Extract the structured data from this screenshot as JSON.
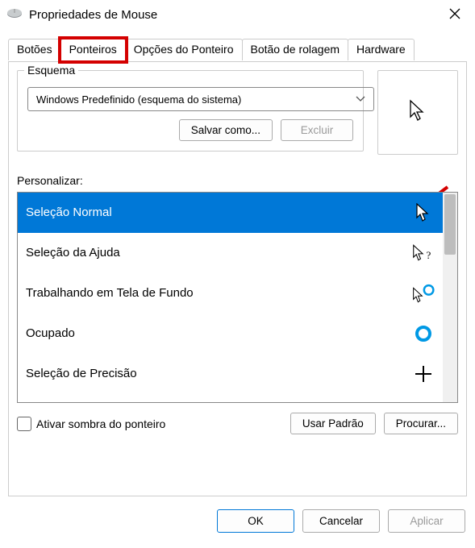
{
  "window": {
    "title": "Propriedades de Mouse"
  },
  "tabs": {
    "t0": "Botões",
    "t1": "Ponteiros",
    "t2": "Opções do Ponteiro",
    "t3": "Botão de rolagem",
    "t4": "Hardware"
  },
  "scheme": {
    "group_label": "Esquema",
    "selected": "Windows Predefinido (esquema do sistema)",
    "save_as": "Salvar como...",
    "delete": "Excluir"
  },
  "personalize": {
    "label": "Personalizar:",
    "items": [
      "Seleção Normal",
      "Seleção da Ajuda",
      "Trabalhando em Tela de Fundo",
      "Ocupado",
      "Seleção de Precisão"
    ]
  },
  "options": {
    "shadow_label": "Ativar sombra do ponteiro",
    "use_default": "Usar Padrão",
    "browse": "Procurar..."
  },
  "footer": {
    "ok": "OK",
    "cancel": "Cancelar",
    "apply": "Aplicar"
  }
}
